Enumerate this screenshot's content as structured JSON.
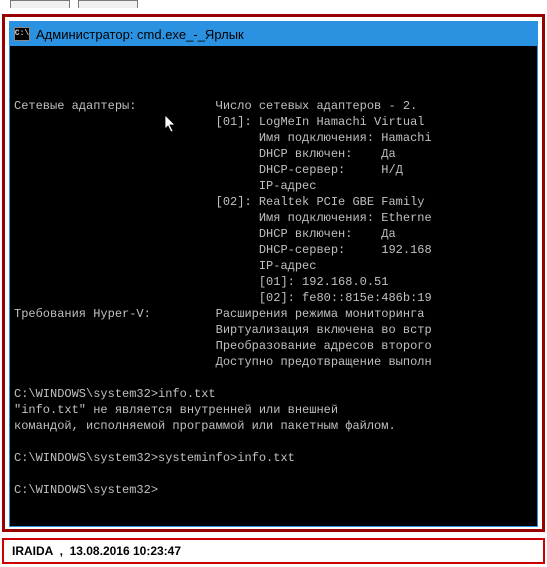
{
  "window": {
    "title": "Администратор: cmd.exe_-_Ярлык",
    "icon_glyph": "C:\\"
  },
  "console": {
    "lines": [
      "Сетевые адаптеры:           Число сетевых адаптеров - 2.",
      "                            [01]: LogMeIn Hamachi Virtual ",
      "                                  Имя подключения: Hamachi",
      "                                  DHCP включен:    Да",
      "                                  DHCP-сервер:     Н/Д",
      "                                  IP-адрес",
      "                            [02]: Realtek PCIe GBE Family ",
      "                                  Имя подключения: Etherne",
      "                                  DHCP включен:    Да",
      "                                  DHCP-сервер:     192.168",
      "                                  IP-адрес",
      "                                  [01]: 192.168.0.51",
      "                                  [02]: fe80::815e:486b:19",
      "Требования Hyper-V:         Расширения режима мониторинга",
      "                            Виртуализация включена во встр",
      "                            Преобразование адресов второго",
      "                            Доступно предотвращение выполн",
      "",
      "C:\\WINDOWS\\system32>info.txt",
      "\"info.txt\" не является внутренней или внешней",
      "командой, исполняемой программой или пакетным файлом.",
      "",
      "C:\\WINDOWS\\system32>systeminfo>info.txt",
      "",
      "C:\\WINDOWS\\system32>"
    ]
  },
  "caption": {
    "author": "IRAIDA",
    "sep": ",",
    "date": "13.08.2016",
    "time": "10:23:47"
  }
}
